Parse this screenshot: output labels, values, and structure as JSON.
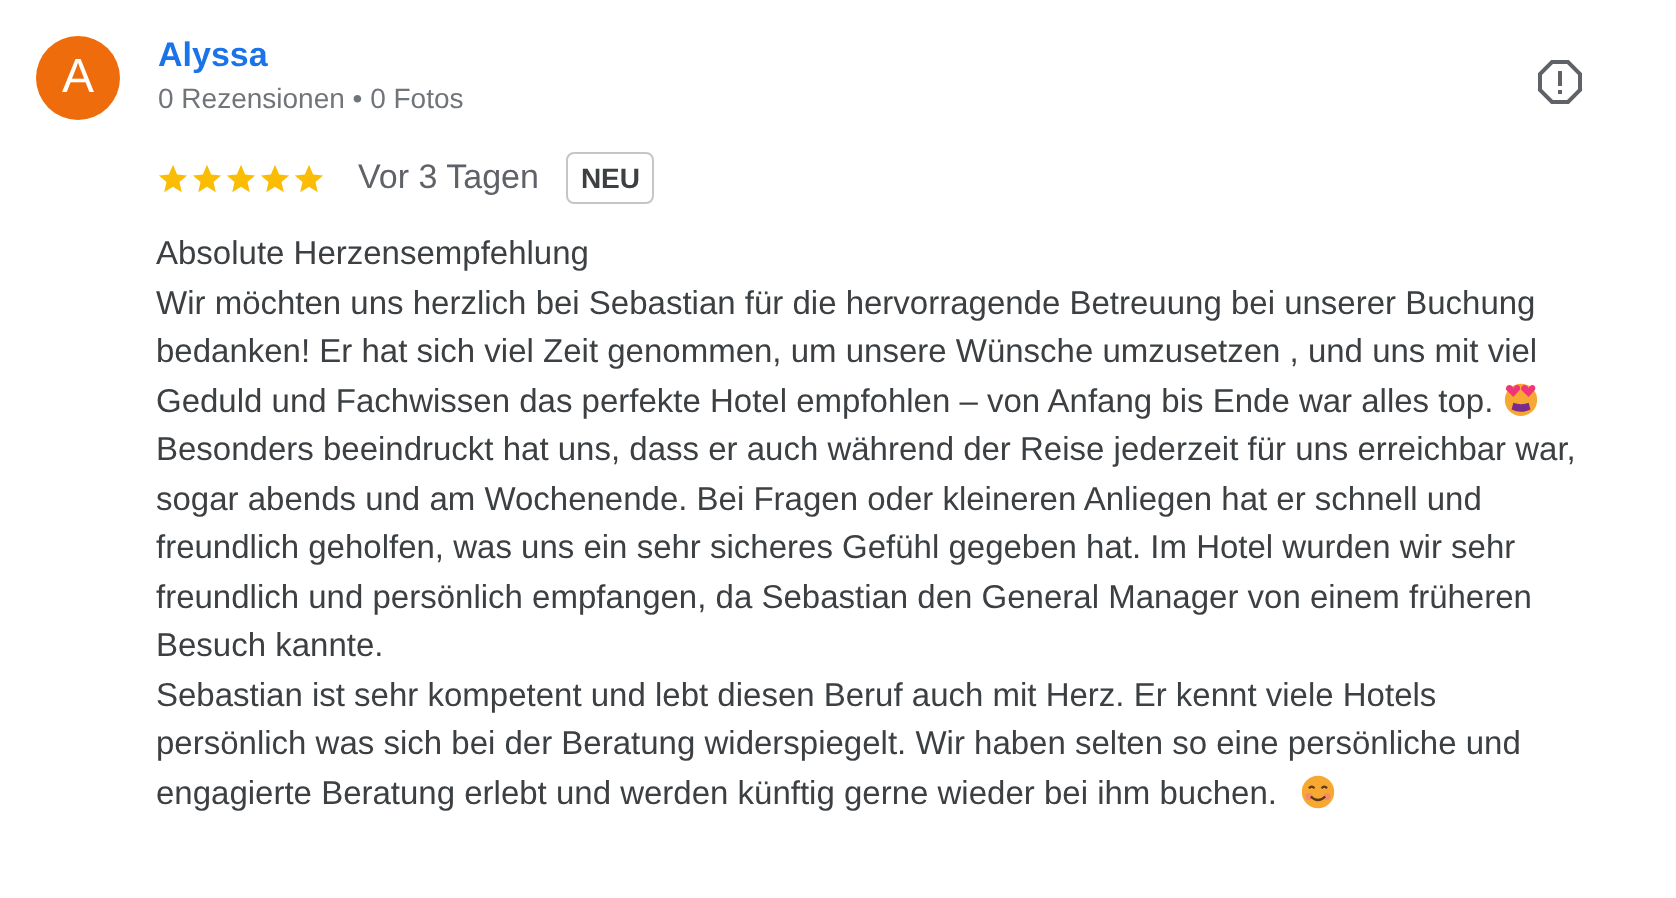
{
  "review": {
    "avatar_letter": "A",
    "author": "Alyssa",
    "meta": "0 Rezensionen • 0 Fotos",
    "stars": 5,
    "date": "Vor 3 Tagen",
    "badge": "NEU",
    "paragraphs": [
      {
        "text": "Absolute Herzensempfehlung",
        "kind": "plain"
      },
      {
        "text": "Wir möchten uns herzlich bei Sebastian für die hervorragende Betreuung bei unserer Buchung bedanken! Er hat sich viel Zeit genommen, um unsere Wünsche umzusetzen , und uns mit viel Geduld und Fachwissen das perfekte Hotel empfohlen – von Anfang bis Ende war alles top.",
        "kind": "heart_eyes"
      },
      {
        "text": "Besonders beeindruckt hat uns, dass er auch während der Reise jederzeit für uns erreichbar war, sogar abends und am Wochenende. Bei Fragen oder kleineren Anliegen hat er schnell und freundlich geholfen, was uns ein sehr sicheres Gefühl gegeben hat. Im Hotel wurden wir sehr freundlich und persönlich empfangen, da Sebastian den General Manager von einem früheren Besuch kannte.",
        "kind": "plain"
      },
      {
        "text": "Sebastian ist sehr kompetent und lebt diesen Beruf auch mit Herz. Er kennt viele Hotels persönlich was sich bei der Beratung widerspiegelt. Wir haben selten so eine persönliche und engagierte Beratung erlebt und werden künftig gerne wieder bei ihm buchen.",
        "kind": "smiling"
      }
    ]
  }
}
